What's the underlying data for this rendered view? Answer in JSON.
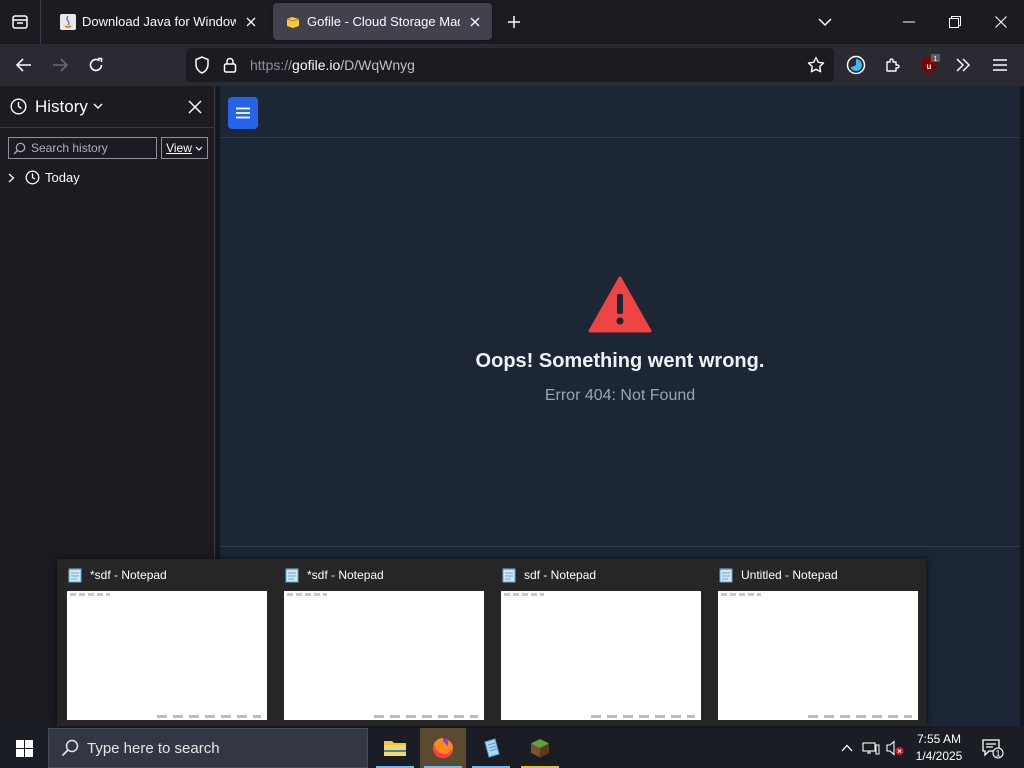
{
  "browser": {
    "tabs": [
      {
        "title": "Download Java for Windows",
        "active": false
      },
      {
        "title": "Gofile - Cloud Storage Made Si",
        "active": true
      }
    ],
    "url": {
      "scheme": "https://",
      "host": "gofile.io",
      "path": "/D/WqWnyg"
    },
    "extension_badge": "1"
  },
  "sidebar": {
    "title": "History",
    "search_placeholder": "Search history",
    "view_label": "View",
    "tree": [
      {
        "label": "Today"
      }
    ]
  },
  "page": {
    "error_title": "Oops! Something went wrong.",
    "error_subtitle": "Error 404: Not Found",
    "accent_color": "#2563eb",
    "warning_color": "#ef4444"
  },
  "taskbar_previews": [
    {
      "title": "*sdf - Notepad"
    },
    {
      "title": "*sdf - Notepad"
    },
    {
      "title": "sdf - Notepad"
    },
    {
      "title": "Untitled - Notepad"
    }
  ],
  "taskbar": {
    "search_placeholder": "Type here to search",
    "apps": [
      "file-explorer-icon",
      "firefox-icon",
      "notepad-icon",
      "minecraft-icon"
    ],
    "time": "7:55 AM",
    "date": "1/4/2025",
    "notification_count": "1"
  }
}
